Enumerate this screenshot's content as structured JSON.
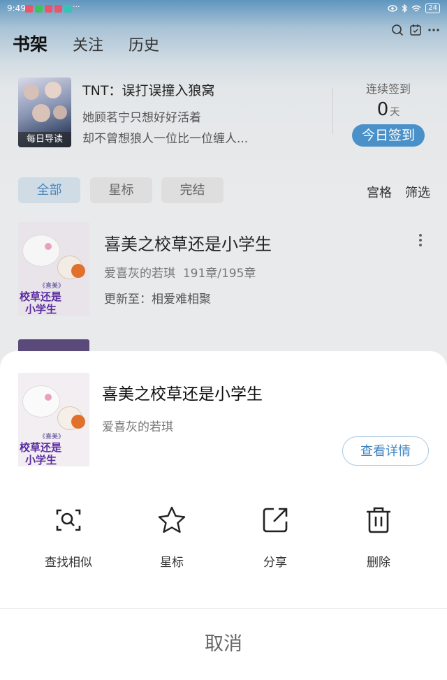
{
  "status_bar": {
    "time": "9:49",
    "battery": "24"
  },
  "top_tabs": [
    {
      "label": "书架"
    },
    {
      "label": "关注"
    },
    {
      "label": "历史"
    }
  ],
  "daily": {
    "cover_label": "每日导读",
    "title": "TNT：误打误撞入狼窝",
    "line1": "她顾茗宁只想好好活着",
    "line2": "却不曾想狼人一位比一位缠人...",
    "checkin_label": "连续签到",
    "checkin_days": "0",
    "checkin_unit": "天",
    "checkin_button": "今日签到"
  },
  "filters": {
    "chips": [
      "全部",
      "星标",
      "完结"
    ],
    "view_mode": "宫格",
    "filter": "筛选"
  },
  "book": {
    "title": "喜美之校草还是小学生",
    "author": "爱喜灰的若琪",
    "progress": "191章/195章",
    "update": "更新至：相爱难相聚",
    "cover_text_top": "《喜美》",
    "cover_text_1": "校草还是",
    "cover_text_2": "小学生"
  },
  "sheet": {
    "title": "喜美之校草还是小学生",
    "author": "爱喜灰的若琪",
    "detail_button": "查看详情",
    "actions": [
      {
        "label": "查找相似",
        "icon": "find-similar-icon"
      },
      {
        "label": "星标",
        "icon": "star-icon"
      },
      {
        "label": "分享",
        "icon": "share-icon"
      },
      {
        "label": "删除",
        "icon": "trash-icon"
      }
    ],
    "cancel": "取消"
  },
  "colors": {
    "accent": "#4b91c9",
    "active_chip_text": "#4b87bd"
  }
}
